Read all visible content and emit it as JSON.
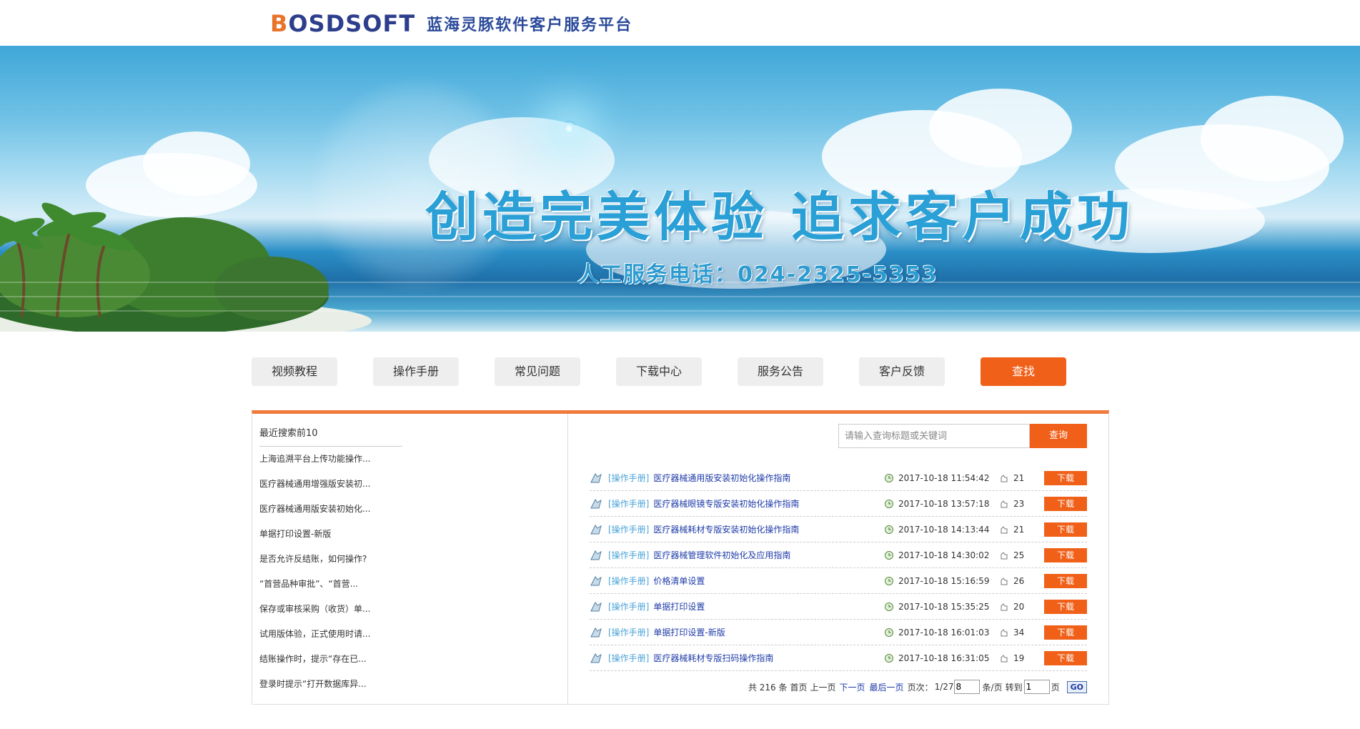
{
  "header": {
    "logo_text": "BOSDSOFT",
    "site_title": "蓝海灵豚软件客户服务平台"
  },
  "banner": {
    "slogan": "创造完美体验  追求客户成功",
    "phone_line": "人工服务电话：024-2325-5353"
  },
  "nav": {
    "items": [
      {
        "label": "视频教程"
      },
      {
        "label": "操作手册"
      },
      {
        "label": "常见问题"
      },
      {
        "label": "下载中心"
      },
      {
        "label": "服务公告"
      },
      {
        "label": "客户反馈"
      },
      {
        "label": "查找"
      }
    ]
  },
  "left": {
    "title": "最近搜索前10",
    "items": [
      "上海追溯平台上传功能操作...",
      "医疗器械通用增强版安装初...",
      "医疗器械通用版安装初始化...",
      "单据打印设置-新版",
      "是否允许反结账，如何操作?",
      "“首营品种审批”、“首营...",
      "保存或审核采购（收货）单...",
      "试用版体验，正式使用时请...",
      "结账操作时，提示“存在已...",
      "登录时提示“打开数据库异..."
    ]
  },
  "search": {
    "placeholder": "请输入查询标题或关键词",
    "button": "查询"
  },
  "results": [
    {
      "category": "[操作手册]",
      "title": "医疗器械通用版安装初始化操作指南",
      "time": "2017-10-18 11:54:42",
      "views": "21",
      "download": "下载"
    },
    {
      "category": "[操作手册]",
      "title": "医疗器械眼镜专版安装初始化操作指南",
      "time": "2017-10-18 13:57:18",
      "views": "23",
      "download": "下载"
    },
    {
      "category": "[操作手册]",
      "title": "医疗器械耗材专版安装初始化操作指南",
      "time": "2017-10-18 14:13:44",
      "views": "21",
      "download": "下载"
    },
    {
      "category": "[操作手册]",
      "title": "医疗器械管理软件初始化及应用指南",
      "time": "2017-10-18 14:30:02",
      "views": "25",
      "download": "下载"
    },
    {
      "category": "[操作手册]",
      "title": "价格清单设置",
      "time": "2017-10-18 15:16:59",
      "views": "26",
      "download": "下载"
    },
    {
      "category": "[操作手册]",
      "title": "单据打印设置",
      "time": "2017-10-18 15:35:25",
      "views": "20",
      "download": "下载"
    },
    {
      "category": "[操作手册]",
      "title": "单据打印设置-新版",
      "time": "2017-10-18 16:01:03",
      "views": "34",
      "download": "下载"
    },
    {
      "category": "[操作手册]",
      "title": "医疗器械耗材专版扫码操作指南",
      "time": "2017-10-18 16:31:05",
      "views": "19",
      "download": "下载"
    }
  ],
  "pager": {
    "total": "共 216 条",
    "first": "首页",
    "prev": "上一页",
    "next": "下一页",
    "last": "最后一页",
    "page_label": "页次：",
    "page_info": "1/27",
    "per_page_value": "8",
    "per_page_label": "条/页",
    "goto_label": "转到",
    "goto_value": "1",
    "page_suffix": "页",
    "go": "GO"
  },
  "colors": {
    "accent": "#f06018",
    "link": "#1e3ba8",
    "category": "#4aa3d8",
    "panel_top_border": "#f07a3c"
  }
}
